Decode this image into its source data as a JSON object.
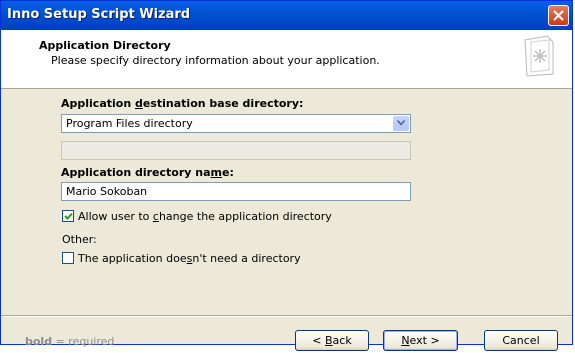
{
  "window": {
    "title": "Inno Setup Script Wizard"
  },
  "header": {
    "title": "Application Directory",
    "subtitle": "Please specify directory information about your application."
  },
  "form": {
    "base_dir_label_pre": "Application ",
    "base_dir_label_u": "d",
    "base_dir_label_post": "estination base directory:",
    "base_dir_value": "Program Files directory",
    "custom_dir_value": "",
    "dir_name_label_pre": "Application directory na",
    "dir_name_label_u": "m",
    "dir_name_label_post": "e:",
    "dir_name_value": "Mario Sokoban",
    "allow_change_checked": true,
    "allow_change_pre": "Allow user to ",
    "allow_change_u": "c",
    "allow_change_post": "hange the application directory",
    "other_label": "Other:",
    "no_dir_checked": false,
    "no_dir_pre": "The application doe",
    "no_dir_u": "s",
    "no_dir_post": "n't need a directory"
  },
  "footer": {
    "note_bold": "bold",
    "note_rest": " = required",
    "back_u": "B",
    "back_pre": "< ",
    "back_post": "ack",
    "next_u": "N",
    "next_post": "ext >",
    "cancel_label": "Cancel"
  },
  "icons": {
    "close": "close-x-icon",
    "header": "document-sparkle-icon",
    "dropdown": "chevron-down-icon",
    "check": "checkmark-icon"
  },
  "colors": {
    "titlebar": "#0052d6",
    "dialog_bg": "#ece9d8",
    "close_button": "#c93b15"
  }
}
